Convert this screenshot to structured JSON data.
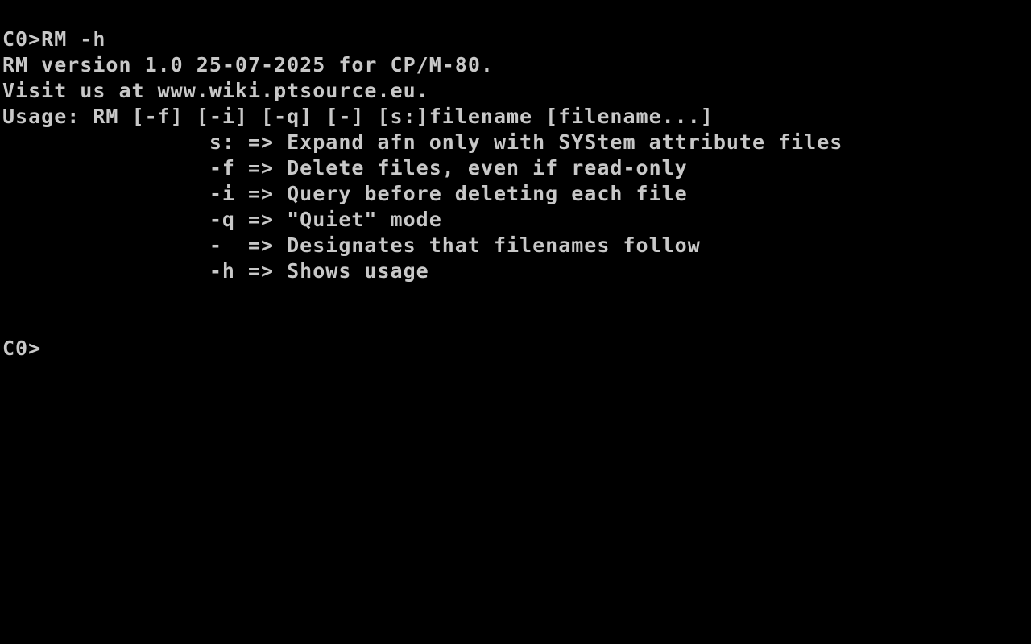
{
  "terminal": {
    "lines": [
      "C0>RM -h",
      "RM version 1.0 25-07-2025 for CP/M-80.",
      "Visit us at www.wiki.ptsource.eu.",
      "Usage: RM [-f] [-i] [-q] [-] [s:]filename [filename...]",
      "                s: => Expand afn only with SYStem attribute files",
      "                -f => Delete files, even if read-only",
      "                -i => Query before deleting each file",
      "                -q => \"Quiet\" mode",
      "                -  => Designates that filenames follow",
      "                -h => Shows usage"
    ],
    "prompt": "C0>",
    "colors": {
      "background": "#000000",
      "text": "#c8c8c8"
    }
  }
}
